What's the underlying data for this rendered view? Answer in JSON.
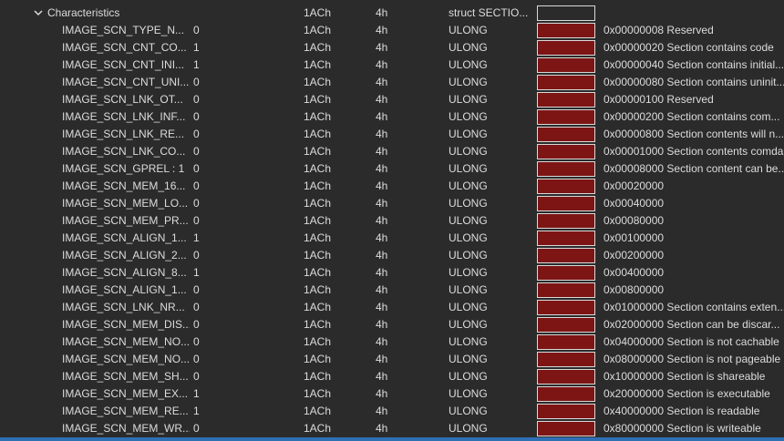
{
  "header": {
    "name": "Characteristics",
    "offset": "1ACh",
    "size": "4h",
    "type": "struct SECTIO..."
  },
  "rows": [
    {
      "name": "IMAGE_SCN_TYPE_N...",
      "value": "0",
      "offset": "1ACh",
      "size": "4h",
      "type": "ULONG",
      "comment": "0x00000008 Reserved"
    },
    {
      "name": "IMAGE_SCN_CNT_CO...",
      "value": "1",
      "offset": "1ACh",
      "size": "4h",
      "type": "ULONG",
      "comment": "0x00000020 Section contains code"
    },
    {
      "name": "IMAGE_SCN_CNT_INI...",
      "value": "1",
      "offset": "1ACh",
      "size": "4h",
      "type": "ULONG",
      "comment": "0x00000040 Section contains initial..."
    },
    {
      "name": "IMAGE_SCN_CNT_UNI...",
      "value": "0",
      "offset": "1ACh",
      "size": "4h",
      "type": "ULONG",
      "comment": "0x00000080 Section contains uninit..."
    },
    {
      "name": "IMAGE_SCN_LNK_OT...",
      "value": "0",
      "offset": "1ACh",
      "size": "4h",
      "type": "ULONG",
      "comment": "0x00000100 Reserved"
    },
    {
      "name": "IMAGE_SCN_LNK_INF...",
      "value": "0",
      "offset": "1ACh",
      "size": "4h",
      "type": "ULONG",
      "comment": "0x00000200 Section contains com..."
    },
    {
      "name": "IMAGE_SCN_LNK_RE...",
      "value": "0",
      "offset": "1ACh",
      "size": "4h",
      "type": "ULONG",
      "comment": "0x00000800 Section contents will n..."
    },
    {
      "name": "IMAGE_SCN_LNK_CO...",
      "value": "0",
      "offset": "1ACh",
      "size": "4h",
      "type": "ULONG",
      "comment": "0x00001000 Section contents comda..."
    },
    {
      "name": "IMAGE_SCN_GPREL : 1",
      "value": "0",
      "offset": "1ACh",
      "size": "4h",
      "type": "ULONG",
      "comment": "0x00008000 Section content can be..."
    },
    {
      "name": "IMAGE_SCN_MEM_16...",
      "value": "0",
      "offset": "1ACh",
      "size": "4h",
      "type": "ULONG",
      "comment": "0x00020000"
    },
    {
      "name": "IMAGE_SCN_MEM_LO...",
      "value": "0",
      "offset": "1ACh",
      "size": "4h",
      "type": "ULONG",
      "comment": "0x00040000"
    },
    {
      "name": "IMAGE_SCN_MEM_PR...",
      "value": "0",
      "offset": "1ACh",
      "size": "4h",
      "type": "ULONG",
      "comment": "0x00080000"
    },
    {
      "name": "IMAGE_SCN_ALIGN_1...",
      "value": "1",
      "offset": "1ACh",
      "size": "4h",
      "type": "ULONG",
      "comment": "0x00100000"
    },
    {
      "name": "IMAGE_SCN_ALIGN_2...",
      "value": "0",
      "offset": "1ACh",
      "size": "4h",
      "type": "ULONG",
      "comment": "0x00200000"
    },
    {
      "name": "IMAGE_SCN_ALIGN_8...",
      "value": "1",
      "offset": "1ACh",
      "size": "4h",
      "type": "ULONG",
      "comment": "0x00400000"
    },
    {
      "name": "IMAGE_SCN_ALIGN_1...",
      "value": "0",
      "offset": "1ACh",
      "size": "4h",
      "type": "ULONG",
      "comment": "0x00800000"
    },
    {
      "name": "IMAGE_SCN_LNK_NR...",
      "value": "0",
      "offset": "1ACh",
      "size": "4h",
      "type": "ULONG",
      "comment": "0x01000000 Section contains exten..."
    },
    {
      "name": "IMAGE_SCN_MEM_DIS...",
      "value": "0",
      "offset": "1ACh",
      "size": "4h",
      "type": "ULONG",
      "comment": "0x02000000 Section can be discar..."
    },
    {
      "name": "IMAGE_SCN_MEM_NO...",
      "value": "0",
      "offset": "1ACh",
      "size": "4h",
      "type": "ULONG",
      "comment": "0x04000000 Section is not cachable"
    },
    {
      "name": "IMAGE_SCN_MEM_NO...",
      "value": "0",
      "offset": "1ACh",
      "size": "4h",
      "type": "ULONG",
      "comment": "0x08000000 Section is not pageable"
    },
    {
      "name": "IMAGE_SCN_MEM_SH...",
      "value": "0",
      "offset": "1ACh",
      "size": "4h",
      "type": "ULONG",
      "comment": "0x10000000 Section is shareable"
    },
    {
      "name": "IMAGE_SCN_MEM_EX...",
      "value": "1",
      "offset": "1ACh",
      "size": "4h",
      "type": "ULONG",
      "comment": "0x20000000 Section is executable"
    },
    {
      "name": "IMAGE_SCN_MEM_RE...",
      "value": "1",
      "offset": "1ACh",
      "size": "4h",
      "type": "ULONG",
      "comment": "0x40000000 Section is readable"
    },
    {
      "name": "IMAGE_SCN_MEM_WR...",
      "value": "0",
      "offset": "1ACh",
      "size": "4h",
      "type": "ULONG",
      "comment": "0x80000000 Section is writeable"
    }
  ],
  "colors": {
    "background": "#2b2b2b",
    "row_color_swatch": "#7d1515",
    "swatch_border": "#d9d9d9",
    "selection": "#2f6fb5",
    "text": "#dcdcdc"
  },
  "icons": {
    "collapse": "chevron-down-icon"
  }
}
